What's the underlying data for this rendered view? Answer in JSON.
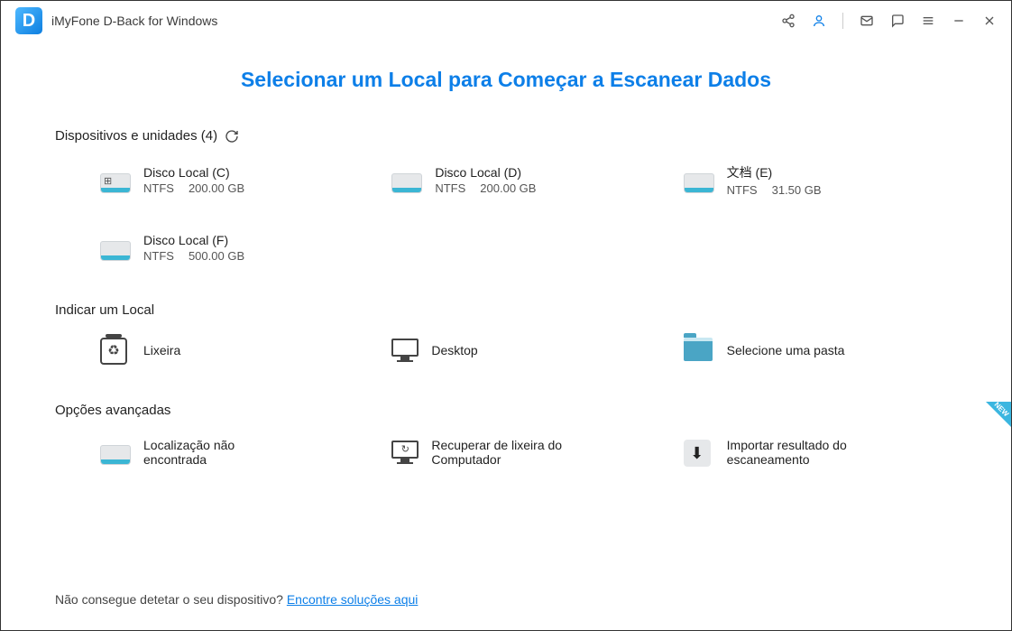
{
  "app": {
    "logo_letter": "D",
    "title": "iMyFone D-Back for Windows"
  },
  "page_title": "Selecionar um Local para Começar a Escanear Dados",
  "sections": {
    "devices": {
      "title": "Dispositivos e unidades (4)",
      "drives": [
        {
          "name": "Disco Local (C)",
          "fs": "NTFS",
          "size": "200.00 GB",
          "win": true
        },
        {
          "name": "Disco Local (D)",
          "fs": "NTFS",
          "size": "200.00 GB",
          "win": false
        },
        {
          "name": "文档 (E)",
          "fs": "NTFS",
          "size": "31.50 GB",
          "win": false
        },
        {
          "name": "Disco Local (F)",
          "fs": "NTFS",
          "size": "500.00 GB",
          "win": false
        }
      ]
    },
    "location": {
      "title": "Indicar um Local",
      "items": [
        {
          "name": "Lixeira"
        },
        {
          "name": "Desktop"
        },
        {
          "name": "Selecione uma pasta"
        }
      ]
    },
    "advanced": {
      "title": "Opções avançadas",
      "items": [
        {
          "name": "Localização não encontrada"
        },
        {
          "name": "Recuperar de lixeira do Computador"
        },
        {
          "name": "Importar resultado do escaneamento",
          "new_badge": "NEW"
        }
      ]
    }
  },
  "footer": {
    "text": "Não consegue detetar o seu dispositivo? ",
    "link": "Encontre soluções aqui"
  }
}
